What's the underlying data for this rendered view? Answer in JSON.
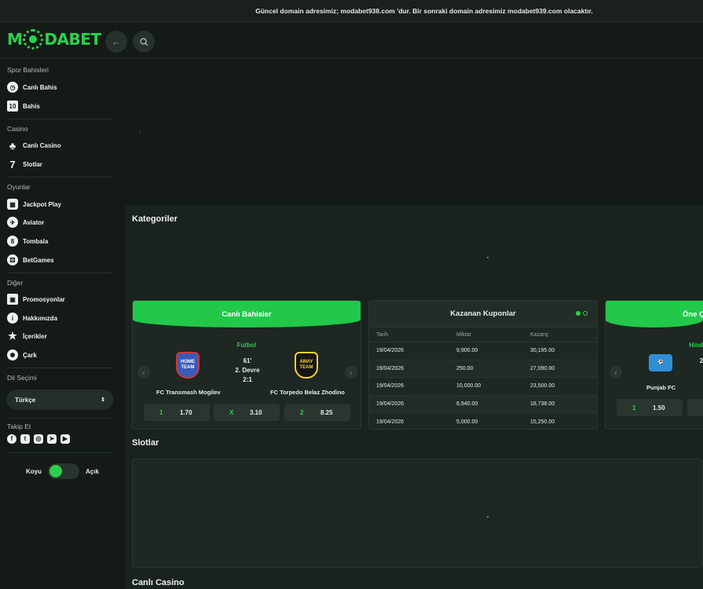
{
  "notice": "Güncel domain adresimiz; modabet938.com 'dur. Bir sonraki domain adresimiz modabet939.com olacaktır.",
  "logo": {
    "prefix": "M",
    "suffix": "DABET"
  },
  "header": {
    "back_icon": "arrow-left-icon",
    "search_icon": "search-icon"
  },
  "sidebar": {
    "sections": [
      {
        "title": "Spor Bahisleri",
        "items": [
          {
            "label": "Canlı Bahis",
            "icon": "stopwatch-icon"
          },
          {
            "label": "Bahis",
            "icon": "jersey-icon"
          }
        ]
      },
      {
        "title": "Casino",
        "items": [
          {
            "label": "Canlı Casino",
            "icon": "club-icon"
          },
          {
            "label": "Slotlar",
            "icon": "seven-icon"
          }
        ]
      },
      {
        "title": "Oyunlar",
        "items": [
          {
            "label": "Jackpot Play",
            "icon": "slot-machine-icon"
          },
          {
            "label": "Aviator",
            "icon": "plane-icon"
          },
          {
            "label": "Tombala",
            "icon": "ball-icon"
          },
          {
            "label": "BetGames",
            "icon": "dice-icon"
          }
        ]
      },
      {
        "title": "Diğer",
        "items": [
          {
            "label": "Promosyonlar",
            "icon": "gift-icon"
          },
          {
            "label": "Hakkımızda",
            "icon": "info-icon"
          },
          {
            "label": "İçerikler",
            "icon": "star-icon"
          },
          {
            "label": "Çark",
            "icon": "wheel-icon"
          }
        ]
      }
    ],
    "language_title": "Dil Seçimi",
    "language_value": "Türkçe",
    "follow_title": "Takip Et",
    "theme": {
      "dark": "Koyu",
      "light": "Açık"
    }
  },
  "main": {
    "categories_title": "Kategoriler",
    "slots_title": "Slotlar",
    "live_casino_title": "Canlı Casino"
  },
  "live_bets": {
    "title": "Canlı Bahisler",
    "sport": "Futbol",
    "home_crest": "HOME TEAM",
    "away_crest": "AWAY TEAM",
    "minute": "61'",
    "period": "2. Devre",
    "score": "2:1",
    "home": "FC Transmash Mogilev",
    "away": "FC Torpedo Belaz Zhodino",
    "odds": [
      {
        "k": "1",
        "v": "1.70"
      },
      {
        "k": "X",
        "v": "3.10"
      },
      {
        "k": "2",
        "v": "8.25"
      }
    ]
  },
  "winning_coupons": {
    "title": "Kazanan Kuponlar",
    "headers": [
      "Tarih",
      "Miktar",
      "Kazanç"
    ],
    "rows": [
      [
        "19/04/2026",
        "9,900.00",
        "30,195.00"
      ],
      [
        "19/04/2026",
        "250.00",
        "27,090.00"
      ],
      [
        "19/04/2026",
        "10,000.00",
        "23,500.00"
      ],
      [
        "19/04/2026",
        "6,940.00",
        "18,738.00"
      ],
      [
        "19/04/2026",
        "5,000.00",
        "15,250.00"
      ]
    ]
  },
  "featured": {
    "title": "Öne Ç",
    "sport": "Hind",
    "team": "Punjab FC",
    "digit": "2",
    "odd_key": "1",
    "odd_value": "1.50"
  }
}
